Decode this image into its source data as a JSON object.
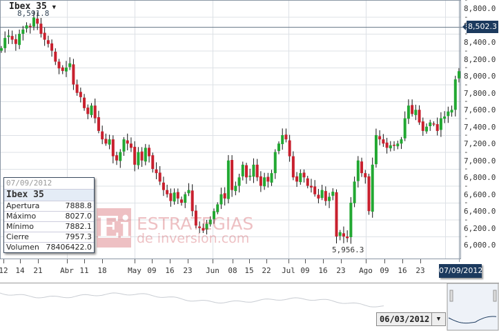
{
  "instrument": {
    "title": "Ibex 35",
    "peak_label": "8,591.8",
    "low_label": "5,956.3",
    "current_price_label": "8,502.3",
    "crosshair_date": "07/09/2012"
  },
  "y_axis": {
    "ticks": [
      "8,800.0",
      "8,600.0",
      "8,400.0",
      "8,200.0",
      "8,000.0",
      "7,800.0",
      "7,600.0",
      "7,400.0",
      "7,200.0",
      "7,000.0",
      "6,800.0",
      "6,600.0",
      "6,400.0",
      "6,200.0",
      "6,000.0"
    ],
    "range": [
      5800,
      8800
    ]
  },
  "x_axis": {
    "ticks": [
      "12",
      "14",
      "21",
      "Abr",
      "11",
      "18",
      "May",
      "09",
      "16",
      "23",
      "Jun",
      "08",
      "15",
      "22",
      "Jul",
      "09",
      "16",
      "23",
      "Ago",
      "09",
      "16",
      "23"
    ]
  },
  "tooltip": {
    "date": "07/09/2012",
    "name": "Ibex 35",
    "rows": [
      {
        "label": "Apertura",
        "value": "7888.8"
      },
      {
        "label": "Máximo",
        "value": "8027.0"
      },
      {
        "label": "Mínimo",
        "value": "7882.1"
      },
      {
        "label": "Cierre",
        "value": "7957.3"
      },
      {
        "label": "Volumen",
        "value": "78406422.0"
      }
    ]
  },
  "watermark": {
    "line1": "ESTRATEGIAS",
    "line2": "de inversion.com",
    "logo": "Ei"
  },
  "navigator": {
    "start_date": "06/03/2012"
  },
  "colors": {
    "up": "#22a832",
    "down": "#c8202e",
    "grid": "#dde1e6",
    "label_bg": "#1c3a5e"
  },
  "chart_data": {
    "type": "candlestick",
    "closes": [
      8230,
      8350,
      8380,
      8330,
      8280,
      8400,
      8450,
      8500,
      8480,
      8592,
      8520,
      8400,
      8330,
      8280,
      8200,
      8070,
      7990,
      7960,
      8000,
      8050,
      7800,
      7700,
      7650,
      7520,
      7450,
      7550,
      7400,
      7250,
      7150,
      7100,
      7150,
      6950,
      6900,
      7000,
      7150,
      7100,
      7050,
      6850,
      7000,
      6900,
      7050,
      6950,
      6800,
      6750,
      6650,
      6550,
      6500,
      6420,
      6520,
      6450,
      6400,
      6500,
      6550,
      6300,
      6130,
      6100,
      6070,
      6150,
      6200,
      6300,
      6380,
      6500,
      6450,
      6900,
      6550,
      6600,
      6700,
      6850,
      6700,
      6720,
      6850,
      6700,
      6600,
      6700,
      6650,
      6750,
      7000,
      7100,
      7200,
      7150,
      6950,
      6700,
      6650,
      6750,
      6700,
      6600,
      6580,
      6500,
      6450,
      6550,
      6420,
      6470,
      6530,
      6000,
      6050,
      6000,
      5980,
      6400,
      6650,
      6900,
      6750,
      6700,
      6300,
      6850,
      7200,
      7150,
      7100,
      7050,
      7080,
      7080,
      7100,
      7150,
      7400,
      7550,
      7450,
      7500,
      7350,
      7250,
      7300,
      7350,
      7330,
      7250,
      7400,
      7420,
      7480,
      7500,
      7860,
      7957
    ]
  }
}
